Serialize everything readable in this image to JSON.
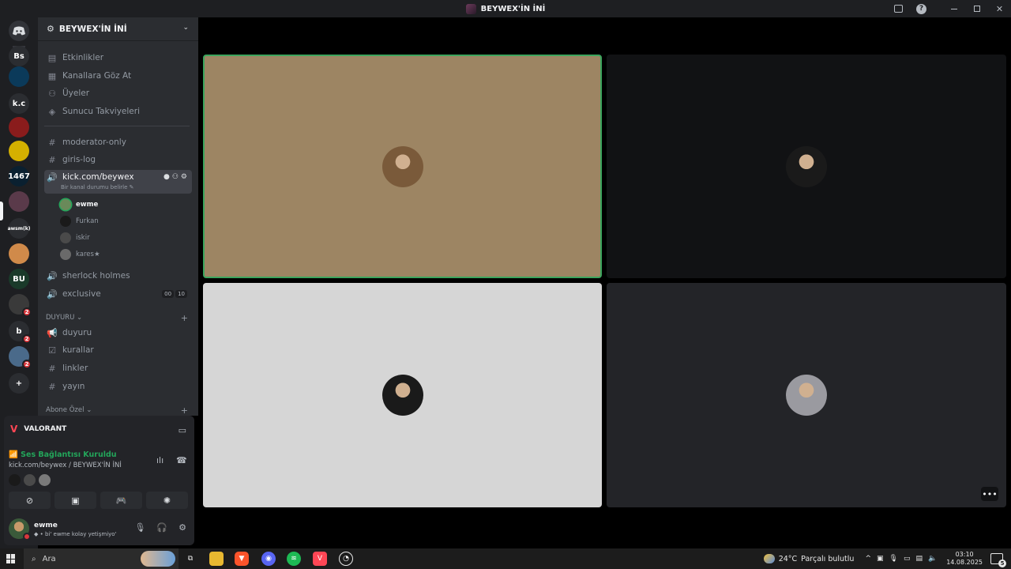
{
  "window": {
    "title": "BEYWEX'İN İNİ"
  },
  "rail": {
    "servers": [
      {
        "label": "",
        "color": "#1e1f22"
      },
      {
        "label": "Bs",
        "color": "#2b2d31"
      },
      {
        "label": "",
        "color": "#0b3a5a"
      },
      {
        "label": "k.c",
        "color": "#2b2d31"
      },
      {
        "label": "",
        "color": "#8a1c1c"
      },
      {
        "label": "",
        "color": "#d4b000"
      },
      {
        "label": "1467",
        "color": "#0a2030"
      },
      {
        "label": "",
        "color": "#5a3a4a",
        "badge": ""
      },
      {
        "label": "awsm(k)",
        "color": "#2b2d31"
      },
      {
        "label": "",
        "color": "#d08a4a"
      },
      {
        "label": "BU",
        "color": "#1a3a2a"
      },
      {
        "label": "",
        "color": "#3a3a3a",
        "badge": "2"
      },
      {
        "label": "b",
        "color": "#2b2d31",
        "badge": "2"
      },
      {
        "label": "",
        "color": "#4a6a8a",
        "badge": "2"
      },
      {
        "label": "+",
        "color": "#2b2d31"
      }
    ]
  },
  "server": {
    "name": "BEYWEX'İN İNİ"
  },
  "nav": [
    {
      "icon": "calendar-icon",
      "glyph": "▤",
      "label": "Etkinlikler"
    },
    {
      "icon": "browse-channels-icon",
      "glyph": "▦",
      "label": "Kanallara Göz At"
    },
    {
      "icon": "members-icon",
      "glyph": "👥",
      "label": "Üyeler"
    },
    {
      "icon": "boost-icon",
      "glyph": "◈",
      "label": "Sunucu Takviyeleri"
    }
  ],
  "channels": [
    {
      "type": "text",
      "label": "moderator-only"
    },
    {
      "type": "text",
      "label": "giris-log"
    },
    {
      "type": "voice",
      "label": "kick.com/beywex",
      "status": "Bir kanal durumu belirle"
    },
    {
      "type": "voice",
      "label": "sherlock holmes"
    },
    {
      "type": "voice",
      "label": "exclusive",
      "counts": [
        "00",
        "10"
      ]
    }
  ],
  "voice_users": [
    {
      "name": "ewme",
      "speaking": true,
      "color": "#6a8a5a"
    },
    {
      "name": "Furkan",
      "speaking": false,
      "color": "#1a1a1a"
    },
    {
      "name": "iskir",
      "speaking": false,
      "color": "#4a4a4a"
    },
    {
      "name": "kares★",
      "speaking": false,
      "color": "#6a6a6a"
    }
  ],
  "categories": [
    {
      "label": "DUYURU",
      "channels": [
        {
          "type": "announce",
          "label": "duyuru"
        },
        {
          "type": "rules",
          "label": "kurallar"
        },
        {
          "type": "text",
          "label": "linkler"
        },
        {
          "type": "text",
          "label": "yayın"
        }
      ]
    },
    {
      "label": "Abone Özel",
      "channels": []
    }
  ],
  "activity": {
    "game": "VALORANT",
    "connection": "Ses Bağlantısı Kuruldu",
    "route": "kick.com/beywex / BEYWEX'İN İNİ"
  },
  "user": {
    "name": "ewme",
    "status": "bi' ewme kolay yetişmiyo'"
  },
  "tiles": [
    {
      "avatar_color": "#7a5a3a"
    },
    {
      "avatar_color": "#1a1a1a"
    },
    {
      "avatar_color": "#1a1a1a"
    },
    {
      "avatar_color": "#9a9aa0"
    }
  ],
  "taskbar": {
    "search_placeholder": "Ara",
    "weather_temp": "24°C",
    "weather_desc": "Parçalı bulutlu",
    "time": "03:10",
    "date": "14.08.2025",
    "notifications": "5"
  },
  "colors": {
    "speaking": "#23a55a",
    "badge": "#da373c",
    "valorant": "#ff4655"
  }
}
